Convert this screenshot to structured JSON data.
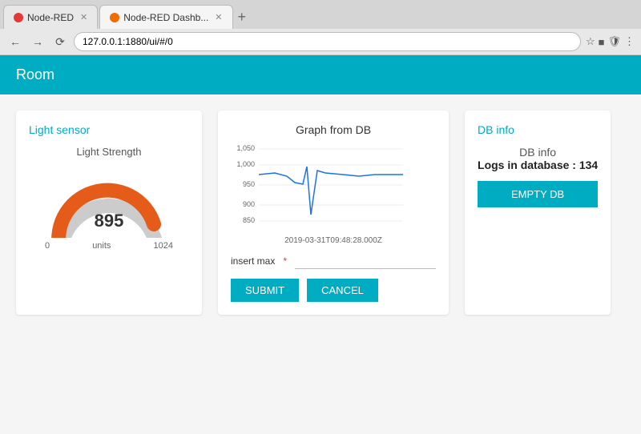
{
  "browser": {
    "tabs": [
      {
        "label": "Node-RED",
        "icon_color": "red",
        "active": false
      },
      {
        "label": "Node-RED Dashb...",
        "icon_color": "orange",
        "active": true
      }
    ],
    "address": "127.0.0.1:1880/ui/#/0",
    "favicon_star": "☆",
    "menu_dots": "⋮"
  },
  "app": {
    "header": "Room"
  },
  "light_sensor": {
    "title": "Light sensor",
    "gauge_label": "Light Strength",
    "value": "895",
    "unit": "units",
    "min": "0",
    "max": "1024",
    "fill_color": "#e55c1a",
    "empty_color": "#cccccc",
    "percent": 0.875
  },
  "graph": {
    "title": "Graph from DB",
    "timestamp": "2019-03-31T09:48:28.000Z",
    "y_labels": [
      "1,050",
      "1,000",
      "950",
      "900",
      "850"
    ],
    "insert_label": "insert max",
    "insert_placeholder": ""
  },
  "db_info": {
    "title": "DB info",
    "info_title": "DB info",
    "logs_label": "Logs in database : 134",
    "empty_db_label": "EMPTY DB"
  },
  "buttons": {
    "submit": "SUBMIT",
    "cancel": "CANCEL"
  }
}
